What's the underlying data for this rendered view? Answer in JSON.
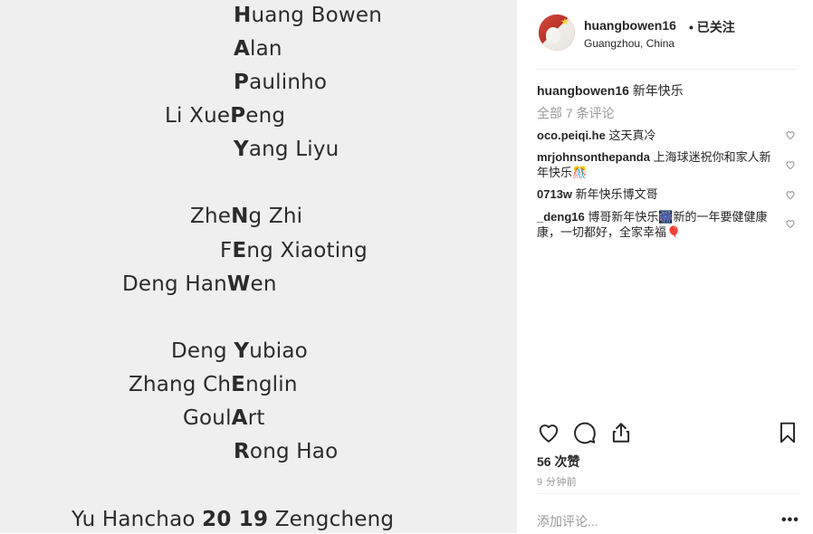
{
  "photo": {
    "lines": [
      {
        "pre": "",
        "bold": "H",
        "post": "uang Bowen"
      },
      {
        "pre": "",
        "bold": "A",
        "post": "lan"
      },
      {
        "pre": "",
        "bold": "P",
        "post": "aulinho"
      },
      {
        "pre": "Li Xue",
        "bold": "P",
        "post": "eng"
      },
      {
        "pre": "",
        "bold": "Y",
        "post": "ang Liyu"
      },
      {
        "pre": "Zhe",
        "bold": "N",
        "post": "g Zhi"
      },
      {
        "pre": "F",
        "bold": "E",
        "post": "ng Xiaoting"
      },
      {
        "pre": "Deng Han",
        "bold": "W",
        "post": "en"
      },
      {
        "pre": "Deng ",
        "bold": "Y",
        "post": "ubiao"
      },
      {
        "pre": "Zhang Ch",
        "bold": "E",
        "post": "nglin"
      },
      {
        "pre": "Goul",
        "bold": "A",
        "post": "rt"
      },
      {
        "pre": "",
        "bold": "R",
        "post": "ong Hao"
      },
      {
        "pre": "Yu Hanchao ",
        "bold": "20 19",
        "post": " Zengcheng"
      }
    ]
  },
  "post": {
    "username": "huangbowen16",
    "follow_label": "• 已关注",
    "location": "Guangzhou, China",
    "caption_user": "huangbowen16",
    "caption_text": " 新年快乐",
    "all_comments": "全部 7 条评论",
    "comments": [
      {
        "user": "oco.peiqi.he",
        "text": " 这天真冷"
      },
      {
        "user": "mrjohnsonthepanda",
        "text": " 上海球迷祝你和家人新年快乐🎊"
      },
      {
        "user": "0713w",
        "text": " 新年快乐博文哥"
      },
      {
        "user": "_deng16",
        "text": " 博哥新年快乐🎆新的一年要健健康康，一切都好，全家幸福🎈"
      }
    ],
    "likes": "56 次赞",
    "time": "9 分钟前",
    "add_comment_placeholder": "添加评论...",
    "more_label": "•••"
  }
}
